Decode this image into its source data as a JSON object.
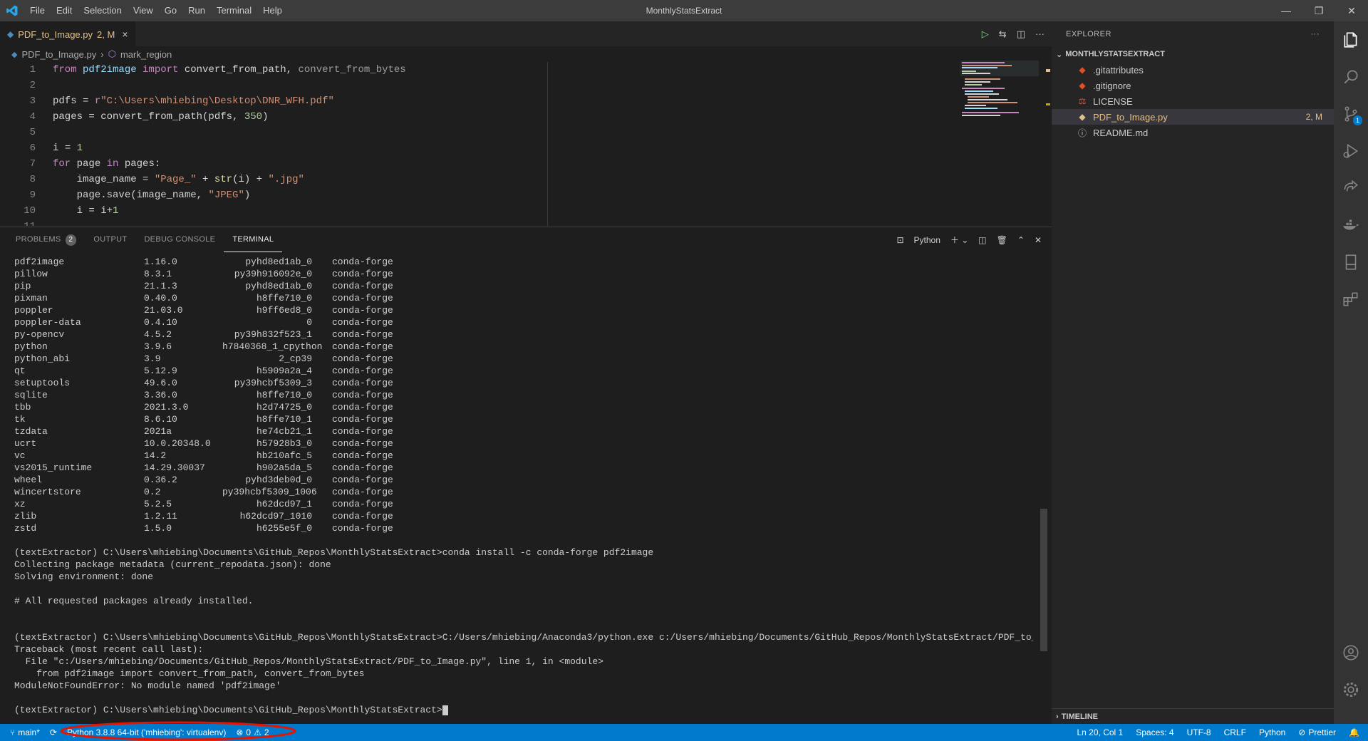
{
  "titlebar": {
    "menu": [
      "File",
      "Edit",
      "Selection",
      "View",
      "Go",
      "Run",
      "Terminal",
      "Help"
    ],
    "title": "MonthlyStatsExtract"
  },
  "tab": {
    "name": "PDF_to_Image.py",
    "status": "2, M",
    "close": "×"
  },
  "breadcrumb": {
    "file": "PDF_to_Image.py",
    "sep": "›",
    "symbol": "mark_region"
  },
  "code": [
    {
      "n": "1",
      "parts": [
        [
          "kw",
          "from "
        ],
        [
          "vr",
          "pdf2image "
        ],
        [
          "kw",
          "import "
        ],
        [
          "op",
          "convert_from_path, "
        ],
        [
          "dim",
          "convert_from_bytes"
        ]
      ]
    },
    {
      "n": "2",
      "parts": []
    },
    {
      "n": "3",
      "parts": [
        [
          "op",
          "pdfs "
        ],
        [
          "op",
          "= "
        ],
        [
          "kw",
          "r"
        ],
        [
          "st",
          "\"C:\\Users\\mhiebing\\Desktop\\DNR_WFH.pdf\""
        ]
      ]
    },
    {
      "n": "4",
      "parts": [
        [
          "op",
          "pages = convert_from_path(pdfs, "
        ],
        [
          "nm",
          "350"
        ],
        [
          "op",
          ")"
        ]
      ]
    },
    {
      "n": "5",
      "parts": []
    },
    {
      "n": "6",
      "parts": [
        [
          "op",
          "i "
        ],
        [
          "op",
          "= "
        ],
        [
          "nm",
          "1"
        ]
      ]
    },
    {
      "n": "7",
      "parts": [
        [
          "kw",
          "for "
        ],
        [
          "op",
          "page "
        ],
        [
          "kw",
          "in "
        ],
        [
          "op",
          "pages:"
        ]
      ]
    },
    {
      "n": "8",
      "parts": [
        [
          "op",
          "    image_name = "
        ],
        [
          "st",
          "\"Page_\" "
        ],
        [
          "op",
          "+ "
        ],
        [
          "fn",
          "str"
        ],
        [
          "op",
          "(i) + "
        ],
        [
          "st",
          "\".jpg\""
        ]
      ]
    },
    {
      "n": "9",
      "parts": [
        [
          "op",
          "    page.save(image_name, "
        ],
        [
          "st",
          "\"JPEG\""
        ],
        [
          "op",
          ")"
        ]
      ]
    },
    {
      "n": "10",
      "parts": [
        [
          "op",
          "    i = i"
        ],
        [
          "op",
          "+"
        ],
        [
          "nm",
          "1"
        ]
      ]
    },
    {
      "n": "11",
      "parts": []
    }
  ],
  "panel": {
    "tabs": [
      "PROBLEMS",
      "OUTPUT",
      "DEBUG CONSOLE",
      "TERMINAL"
    ],
    "problems_count": "2",
    "shell": "Python"
  },
  "terminal": {
    "packages": [
      [
        "pdf2image",
        "1.16.0",
        "pyhd8ed1ab_0",
        "conda-forge"
      ],
      [
        "pillow",
        "8.3.1",
        "py39h916092e_0",
        "conda-forge"
      ],
      [
        "pip",
        "21.1.3",
        "pyhd8ed1ab_0",
        "conda-forge"
      ],
      [
        "pixman",
        "0.40.0",
        "h8ffe710_0",
        "conda-forge"
      ],
      [
        "poppler",
        "21.03.0",
        "h9ff6ed8_0",
        "conda-forge"
      ],
      [
        "poppler-data",
        "0.4.10",
        "0",
        "conda-forge"
      ],
      [
        "py-opencv",
        "4.5.2",
        "py39h832f523_1",
        "conda-forge"
      ],
      [
        "python",
        "3.9.6",
        "h7840368_1_cpython",
        "conda-forge"
      ],
      [
        "python_abi",
        "3.9",
        "2_cp39",
        "conda-forge"
      ],
      [
        "qt",
        "5.12.9",
        "h5909a2a_4",
        "conda-forge"
      ],
      [
        "setuptools",
        "49.6.0",
        "py39hcbf5309_3",
        "conda-forge"
      ],
      [
        "sqlite",
        "3.36.0",
        "h8ffe710_0",
        "conda-forge"
      ],
      [
        "tbb",
        "2021.3.0",
        "h2d74725_0",
        "conda-forge"
      ],
      [
        "tk",
        "8.6.10",
        "h8ffe710_1",
        "conda-forge"
      ],
      [
        "tzdata",
        "2021a",
        "he74cb21_1",
        "conda-forge"
      ],
      [
        "ucrt",
        "10.0.20348.0",
        "h57928b3_0",
        "conda-forge"
      ],
      [
        "vc",
        "14.2",
        "hb210afc_5",
        "conda-forge"
      ],
      [
        "vs2015_runtime",
        "14.29.30037",
        "h902a5da_5",
        "conda-forge"
      ],
      [
        "wheel",
        "0.36.2",
        "pyhd3deb0d_0",
        "conda-forge"
      ],
      [
        "wincertstore",
        "0.2",
        "py39hcbf5309_1006",
        "conda-forge"
      ],
      [
        "xz",
        "5.2.5",
        "h62dcd97_1",
        "conda-forge"
      ],
      [
        "zlib",
        "1.2.11",
        "h62dcd97_1010",
        "conda-forge"
      ],
      [
        "zstd",
        "1.5.0",
        "h6255e5f_0",
        "conda-forge"
      ]
    ],
    "lines": [
      "",
      "(textExtractor) C:\\Users\\mhiebing\\Documents\\GitHub_Repos\\MonthlyStatsExtract>conda install -c conda-forge pdf2image",
      "Collecting package metadata (current_repodata.json): done",
      "Solving environment: done",
      "",
      "# All requested packages already installed.",
      "",
      "",
      "(textExtractor) C:\\Users\\mhiebing\\Documents\\GitHub_Repos\\MonthlyStatsExtract>C:/Users/mhiebing/Anaconda3/python.exe c:/Users/mhiebing/Documents/GitHub_Repos/MonthlyStatsExtract/PDF_to_Image.py",
      "Traceback (most recent call last):",
      "  File \"c:/Users/mhiebing/Documents/GitHub_Repos/MonthlyStatsExtract/PDF_to_Image.py\", line 1, in <module>",
      "    from pdf2image import convert_from_path, convert_from_bytes",
      "ModuleNotFoundError: No module named 'pdf2image'",
      ""
    ],
    "prompt": "(textExtractor) C:\\Users\\mhiebing\\Documents\\GitHub_Repos\\MonthlyStatsExtract>"
  },
  "explorer": {
    "header": "EXPLORER",
    "more": "···",
    "folder": "MONTHLYSTATSEXTRACT",
    "files": [
      {
        "name": ".gitattributes",
        "icon": "git-icon",
        "color": "#e44d26",
        "status": ""
      },
      {
        "name": ".gitignore",
        "icon": "git-icon",
        "color": "#e44d26",
        "status": ""
      },
      {
        "name": "LICENSE",
        "icon": "license-icon",
        "color": "#f1502f",
        "status": ""
      },
      {
        "name": "PDF_to_Image.py",
        "icon": "python-icon",
        "color": "#e2c08d",
        "status": "2, M"
      },
      {
        "name": "README.md",
        "icon": "info-icon",
        "color": "#cccccc",
        "status": ""
      }
    ],
    "timeline": "TIMELINE"
  },
  "activity": {
    "scm_badge": "1"
  },
  "statusbar": {
    "branch": "main*",
    "interpreter": "Python 3.8.8 64-bit ('mhiebing': virtualenv)",
    "errors": "0",
    "warnings": "2",
    "position": "Ln 20, Col 1",
    "spaces": "Spaces: 4",
    "encoding": "UTF-8",
    "eol": "CRLF",
    "language": "Python",
    "formatter": "Prettier"
  },
  "colors": {
    "accent": "#007acc",
    "modified": "#e2c08d",
    "annotation": "#e51400"
  }
}
